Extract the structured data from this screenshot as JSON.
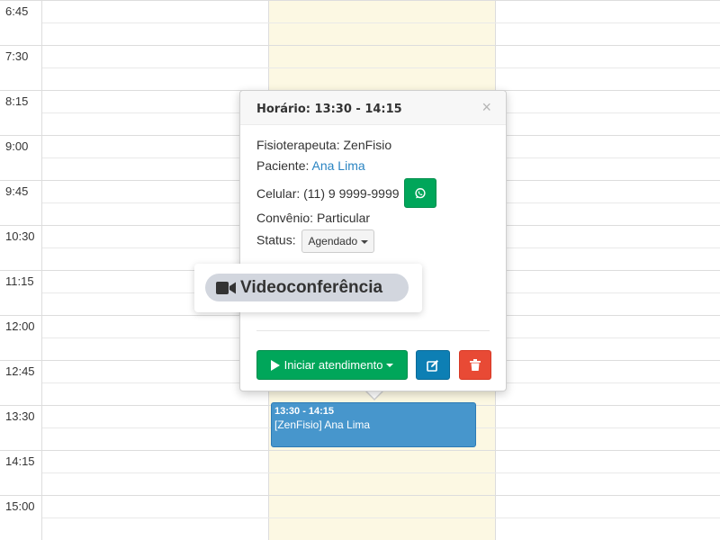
{
  "calendar": {
    "time_labels": [
      "6:45",
      "7:30",
      "8:15",
      "9:00",
      "9:45",
      "10:30",
      "11:15",
      "12:00",
      "12:45",
      "13:30",
      "14:15",
      "15:00"
    ]
  },
  "event": {
    "time": "13:30 - 14:15",
    "title": "[ZenFisio] Ana Lima",
    "color": "#4796cc"
  },
  "popover": {
    "title": "Horário: 13:30 - 14:15",
    "close_icon": "×",
    "therapist_label": "Fisioterapeuta: ",
    "therapist_value": "ZenFisio",
    "patient_label": "Paciente: ",
    "patient_value": "Ana Lima",
    "phone_label": "Celular: ",
    "phone_value": "(11) 9 9999-9999",
    "whatsapp_icon": "whatsapp-icon",
    "insurance_label": "Convênio: ",
    "insurance_value": "Particular",
    "status_label": "Status:",
    "status_value": "Agendado",
    "start_button": "Iniciar atendimento",
    "edit_icon": "edit-icon",
    "delete_icon": "trash-icon"
  },
  "video": {
    "label": "Videoconferência",
    "icon": "video-camera-icon"
  },
  "colors": {
    "today_column": "#fcf8e3",
    "success": "#00a65a",
    "primary": "#0d7fb4",
    "danger": "#e84a35",
    "link": "#2a84c2"
  }
}
